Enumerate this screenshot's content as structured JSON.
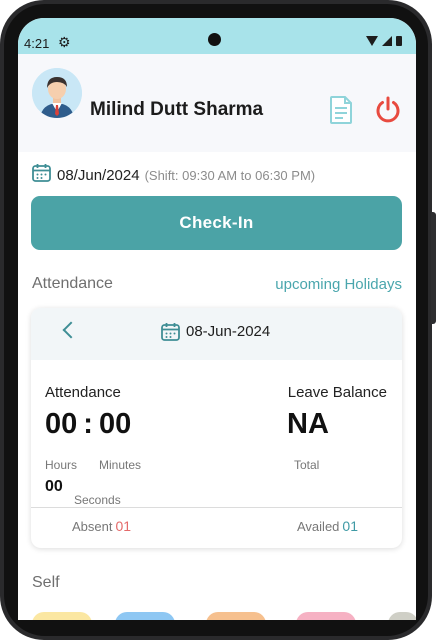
{
  "status_bar": {
    "time": "4:21"
  },
  "header": {
    "user_name": "Milind Dutt Sharma"
  },
  "shift": {
    "date": "08/Jun/2024",
    "shift_text": "(Shift: 09:30 AM to 06:30 PM)"
  },
  "check_in_label": "Check-In",
  "attendance_section": {
    "title": "Attendance",
    "holidays_link": "upcoming Holidays"
  },
  "card": {
    "date": "08-Jun-2024",
    "attendance_label": "Attendance",
    "leave_balance_label": "Leave Balance",
    "hours": "00",
    "separator": ":",
    "minutes": "00",
    "hours_label": "Hours",
    "minutes_label": "Minutes",
    "leave_value": "NA",
    "total_label": "Total",
    "seconds": "00",
    "seconds_label": "Seconds",
    "absent_label": "Absent",
    "absent_value": "01",
    "availed_label": "Availed",
    "availed_value": "01"
  },
  "self_section": {
    "title": "Self"
  },
  "colors": {
    "status_bar": "#a8e3ea",
    "accent": "#4ba3a6",
    "absent": "#e46a6a",
    "availed": "#3f9aa5",
    "power": "#e84a3f"
  },
  "icons": [
    "settings-icon",
    "wifi-icon",
    "signal-icon",
    "battery-icon",
    "document-icon",
    "power-icon",
    "calendar-icon",
    "chevron-left-icon"
  ]
}
